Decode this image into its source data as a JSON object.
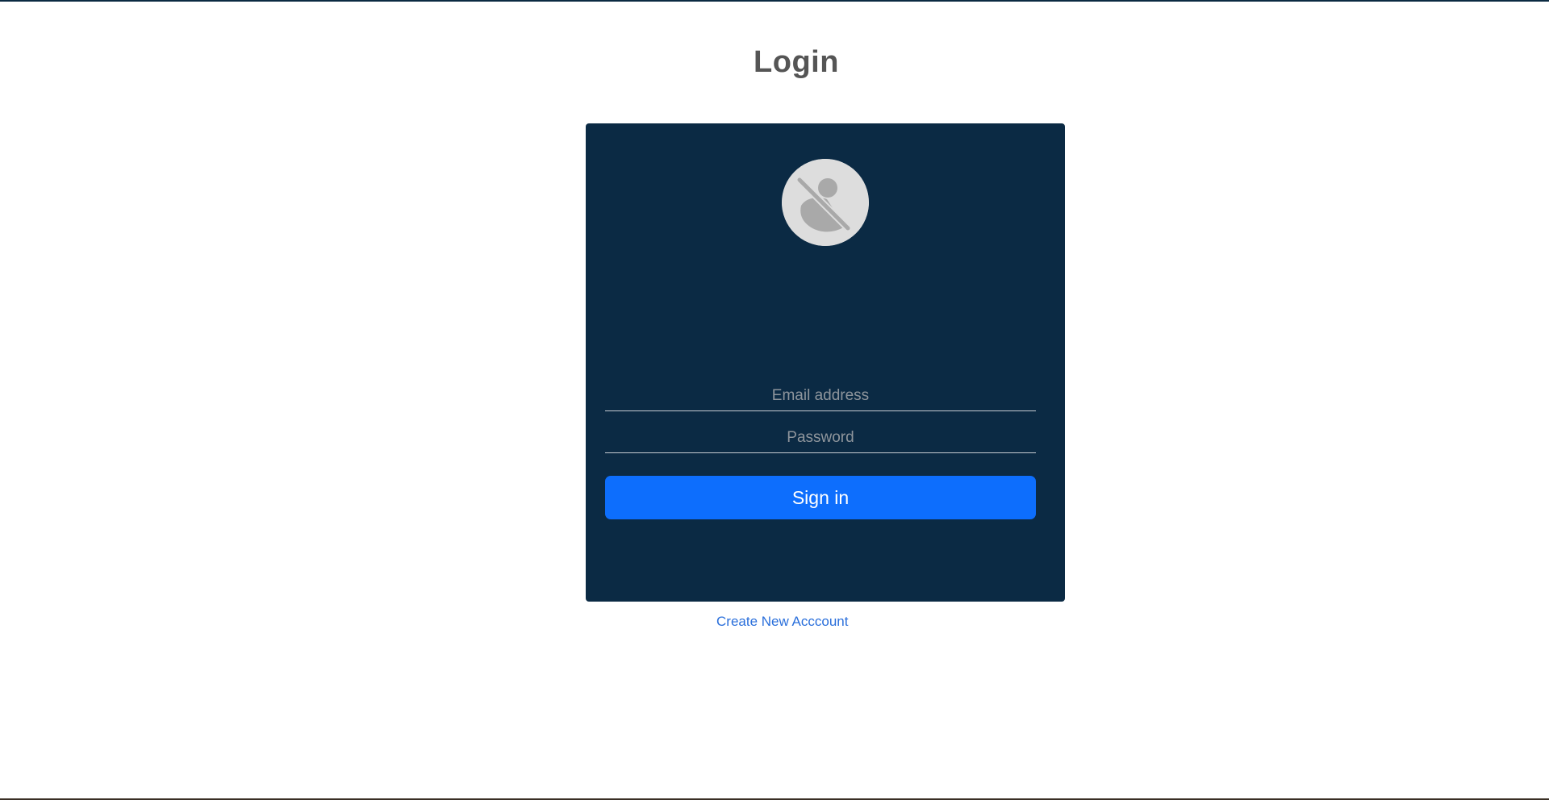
{
  "page": {
    "title": "Login"
  },
  "login_form": {
    "avatar_icon": "user-slash-icon",
    "email_placeholder": "Email address",
    "password_placeholder": "Password",
    "signin_label": "Sign in"
  },
  "footer": {
    "create_account_label": "Create New Acccount"
  },
  "colors": {
    "card_background": "#0b2a44",
    "primary_button": "#0d6efd",
    "link": "#2a6fdb",
    "title_text": "#555555"
  }
}
